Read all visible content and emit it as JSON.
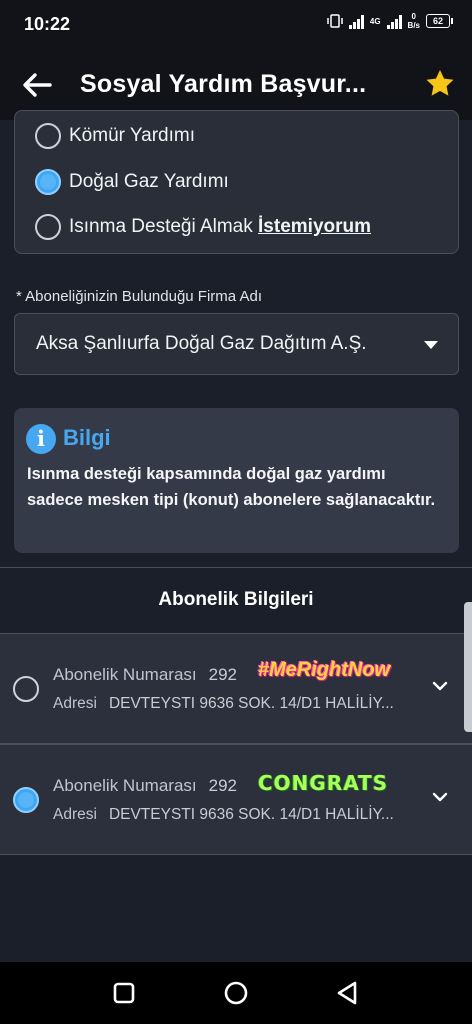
{
  "status": {
    "time": "10:22",
    "network": "4G",
    "speed_value": "0",
    "speed_unit": "B/s",
    "battery": "62"
  },
  "appbar": {
    "title": "Sosyal Yardım Başvur...",
    "back_icon": "arrow-left-icon",
    "favorite_icon": "star-icon",
    "star_color": "#f5c518"
  },
  "heating_options": {
    "items": [
      {
        "label": "Kömür Yardımı",
        "selected": false
      },
      {
        "label": "Doğal Gaz Yardımı",
        "selected": true
      },
      {
        "label_prefix": "Isınma Desteği Almak ",
        "label_emphasis": "İstemiyorum",
        "selected": false
      }
    ]
  },
  "firm": {
    "label": "* Aboneliğinizin Bulunduğu Firma Adı",
    "value": "Aksa Şanlıurfa Doğal Gaz Dağıtım A.Ş."
  },
  "info": {
    "title": "Bilgi",
    "icon_glyph": "i",
    "text": "Isınma desteği kapsamında doğal gaz yardımı sadece mesken tipi (konut) abonelere sağlanacaktır.",
    "accent": "#46a8f0"
  },
  "subscriptions": {
    "title": "Abonelik Bilgileri",
    "items": [
      {
        "number_label": "Abonelik Numarası",
        "number_value": "292",
        "sticker": "#MeRightNow",
        "address_label": "Adresi",
        "address_value": "DEVTEYSTI 9636 SOK. 14/D1 HALİLİY...",
        "selected": false
      },
      {
        "number_label": "Abonelik Numarası",
        "number_value": "292",
        "sticker": "CONGRATS",
        "address_label": "Adresi",
        "address_value": "DEVTEYSTI 9636 SOK. 14/D1 HALİLİY...",
        "selected": true
      }
    ]
  },
  "navbar": {
    "icons": [
      "recents-square-icon",
      "home-circle-icon",
      "back-triangle-icon"
    ]
  }
}
